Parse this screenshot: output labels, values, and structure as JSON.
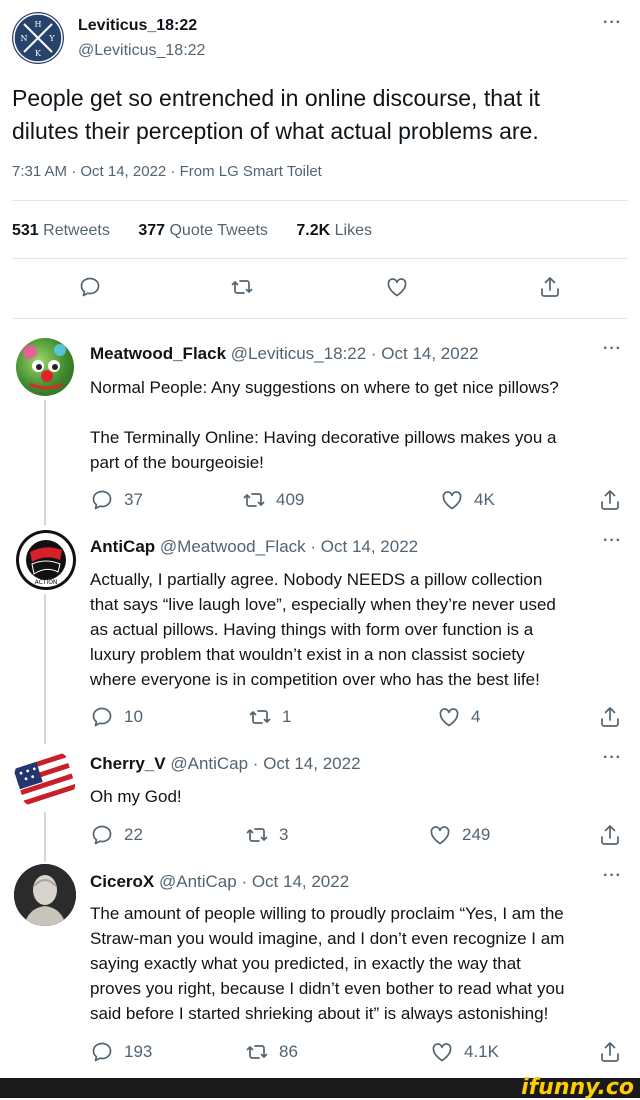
{
  "main_tweet": {
    "display_name": "Leviticus_18:22",
    "handle": "@Leviticus_18:22",
    "avatar_label": "ΝΑΥΚ",
    "text_line1": "People get so entrenched in online discourse, that it",
    "text_line2": "dilutes their perception of what actual problems are.",
    "meta": "7:31 AM · Oct 14, 2022 · From LG Smart Toilet",
    "stats": {
      "retweets_count": "531",
      "retweets_label": "Retweets",
      "quotes_count": "377",
      "quotes_label": "Quote Tweets",
      "likes_count": "7.2K",
      "likes_label": "Likes"
    },
    "more": "···"
  },
  "replies": [
    {
      "display_name": "Meatwood_Flack",
      "meta": "@Leviticus_18:22 · Oct 14, 2022",
      "lines": [
        "Normal People: Any suggestions on where to get nice pillows?",
        "",
        "The Terminally Online: Having decorative pillows makes you a",
        "part of the bourgeoisie!"
      ],
      "replies": "37",
      "retweets": "409",
      "likes": "4K",
      "more": "···"
    },
    {
      "display_name": "AntiCap",
      "meta": "@Meatwood_Flack · Oct 14, 2022",
      "lines": [
        "Actually, I partially agree. Nobody NEEDS a pillow collection",
        "that says “live laugh love”, especially when they’re never used",
        "as actual pillows. Having things with form over function is a",
        "luxury problem that wouldn’t exist in a non classist society",
        "where everyone is in competition over who has the best life!"
      ],
      "replies": "10",
      "retweets": "1",
      "likes": "4",
      "more": "···"
    },
    {
      "display_name": "Cherry_V",
      "meta": "@AntiCap · Oct 14, 2022",
      "lines": [
        "Oh my God!"
      ],
      "replies": "22",
      "retweets": "3",
      "likes": "249",
      "more": "···"
    },
    {
      "display_name": "CiceroX",
      "meta": "@AntiCap · Oct 14, 2022",
      "lines": [
        "The amount of people willing to proudly proclaim “Yes, I am the",
        "Straw-man you would imagine, and I don’t even recognize I am",
        "saying exactly what you predicted, in exactly the way that",
        "proves you right, because I didn’t even bother to read what you",
        "said before I started shrieking about it” is always astonishing!"
      ],
      "replies": "193",
      "retweets": "86",
      "likes": "4.1K",
      "more": "···"
    }
  ],
  "watermark": "ifunny.co",
  "colors": {
    "text": "#0f1419",
    "muted": "#536471",
    "border": "#e1e6ea",
    "watermark": "#ffcc00"
  },
  "icons": [
    "reply-icon",
    "retweet-icon",
    "like-icon",
    "share-icon"
  ]
}
